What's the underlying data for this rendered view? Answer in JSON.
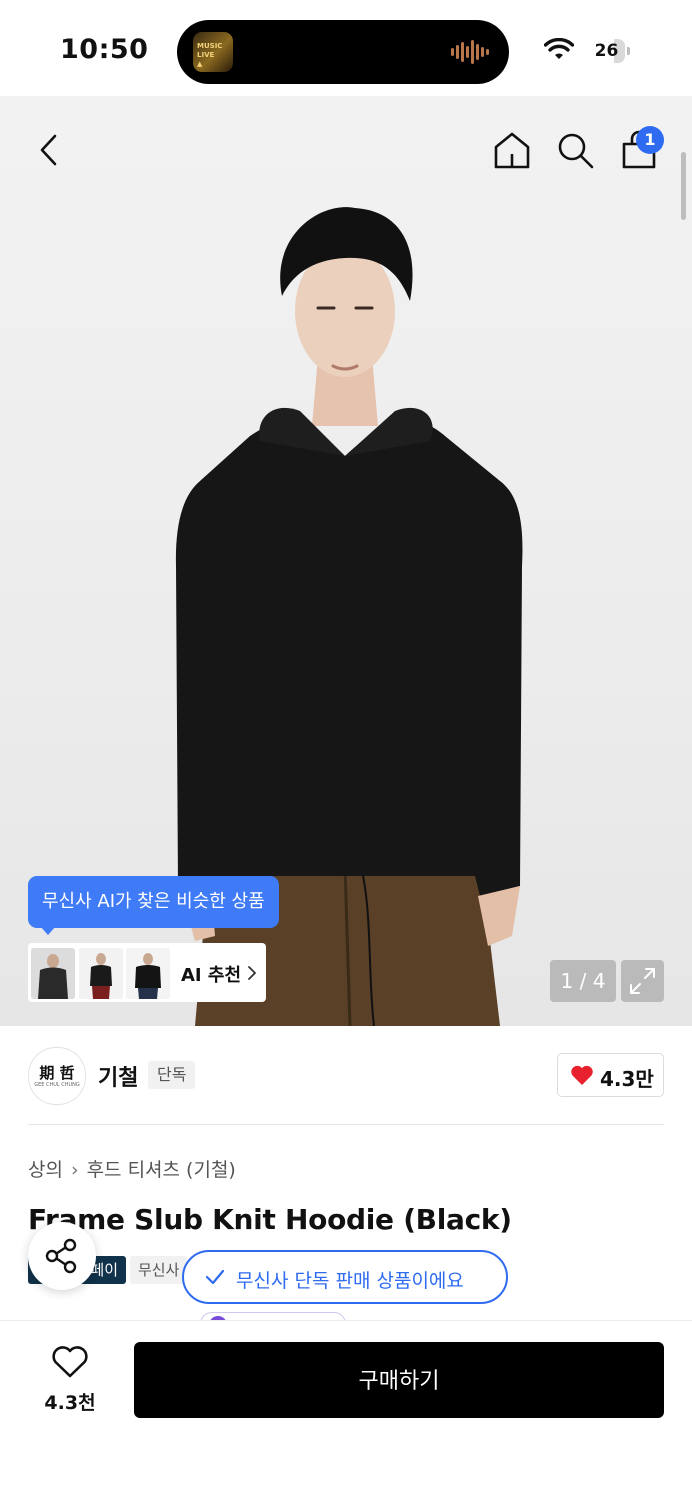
{
  "status_bar": {
    "time": "10:50",
    "battery": "26"
  },
  "header": {
    "back_icon": "chevron-left-icon",
    "home_icon": "home-icon",
    "search_icon": "search-icon",
    "cart_icon": "shopping-bag-icon",
    "cart_count": "1"
  },
  "gallery": {
    "counter": "1 / 4",
    "ai_tooltip": "무신사 AI가 찾은 비슷한 상품",
    "ai_recommend_label": "AI 추천",
    "expand_icon": "expand-icon"
  },
  "brand": {
    "logo_text": "期 哲",
    "logo_subtext": "GEE CHUL CHUNG",
    "name": "기철",
    "tag": "단독",
    "like_count": "4.3만"
  },
  "product": {
    "breadcrumb": [
      "상의",
      "후드 티셔츠 (기철)"
    ],
    "title": "Frame Slub Knit Hoodie (Black)",
    "tag_dark": "페이",
    "tag_gray": "무신사"
  },
  "toast": {
    "text": "무신사 단독 판매 상품이에요"
  },
  "bottom_bar": {
    "wish_count": "4.3천",
    "buy_label": "구매하기"
  },
  "colors": {
    "accent_blue": "#2f6bf0",
    "tooltip_blue": "#3f7bf6",
    "like_red": "#e8212e",
    "buy_black": "#000000"
  }
}
